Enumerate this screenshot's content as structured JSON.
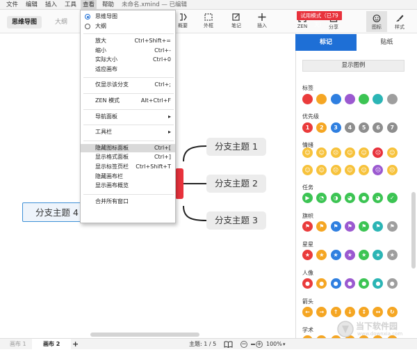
{
  "menubar": [
    "文件",
    "编辑",
    "插入",
    "工具",
    "查看",
    "帮助"
  ],
  "window_title": "未命名.xmind — 已编辑",
  "toolbar": {
    "view_tabs": [
      "思维导图",
      "大纲"
    ],
    "buttons": [
      {
        "label": "概要",
        "icon": "summary-icon"
      },
      {
        "label": "外框",
        "icon": "boundary-icon"
      },
      {
        "label": "笔记",
        "icon": "note-icon"
      },
      {
        "label": "插入",
        "icon": "plus-icon"
      },
      {
        "label": "ZEN",
        "icon": "zen-icon"
      },
      {
        "label": "分享",
        "icon": "share-icon"
      },
      {
        "label": "图标",
        "icon": "emoji-icon"
      },
      {
        "label": "样式",
        "icon": "brush-icon"
      }
    ],
    "trial_badge": "试用模式（已79天）"
  },
  "dropdown": {
    "view_modes": [
      {
        "label": "思维导图",
        "selected": true
      },
      {
        "label": "大纲",
        "selected": false
      }
    ],
    "groups": [
      [
        {
          "label": "放大",
          "shortcut": "Ctrl+Shift+="
        },
        {
          "label": "缩小",
          "shortcut": "Ctrl+-"
        },
        {
          "label": "实际大小",
          "shortcut": "Ctrl+0"
        },
        {
          "label": "适应画布",
          "shortcut": ""
        }
      ],
      [
        {
          "label": "仅显示该分支",
          "shortcut": "Ctrl+;"
        }
      ],
      [
        {
          "label": "ZEN 模式",
          "shortcut": "Alt+Ctrl+F"
        }
      ],
      [
        {
          "label": "导航面板",
          "shortcut": "▸"
        }
      ],
      [
        {
          "label": "工具栏",
          "shortcut": "▸"
        }
      ],
      [
        {
          "label": "隐藏图标面板",
          "shortcut": "Ctrl+[",
          "highlight": true
        },
        {
          "label": "显示格式面板",
          "shortcut": "Ctrl+]"
        },
        {
          "label": "显示标签页栏",
          "shortcut": "Ctrl+Shift+T"
        },
        {
          "label": "隐藏画布栏",
          "shortcut": ""
        },
        {
          "label": "显示画布概览",
          "shortcut": ""
        }
      ],
      [
        {
          "label": "合并所有窗口",
          "shortcut": ""
        }
      ]
    ]
  },
  "canvas": {
    "topics": [
      "分支主题 1",
      "分支主题 2",
      "分支主题 3",
      "分支主题 4"
    ]
  },
  "panel": {
    "tabs": [
      "标记",
      "贴纸"
    ],
    "show_legend": "显示图例",
    "categories": [
      {
        "name": "标签",
        "icons": [
          {
            "c": "#ea3b3b",
            "t": ""
          },
          {
            "c": "#f5a623",
            "t": ""
          },
          {
            "c": "#2f7fe0",
            "t": ""
          },
          {
            "c": "#9b59d0",
            "t": ""
          },
          {
            "c": "#3cc453",
            "t": ""
          },
          {
            "c": "#2bb5b5",
            "t": ""
          },
          {
            "c": "#9e9e9e",
            "t": ""
          }
        ]
      },
      {
        "name": "优先级",
        "icons": [
          {
            "c": "#ea3b3b",
            "t": "1"
          },
          {
            "c": "#f5a623",
            "t": "2"
          },
          {
            "c": "#2f7fe0",
            "t": "3"
          },
          {
            "c": "#8e8e8e",
            "t": "4"
          },
          {
            "c": "#8e8e8e",
            "t": "5"
          },
          {
            "c": "#8e8e8e",
            "t": "6"
          },
          {
            "c": "#8e8e8e",
            "t": "7"
          }
        ]
      },
      {
        "name": "情绪",
        "icons": [
          {
            "c": "#f7c23b",
            "t": "☺"
          },
          {
            "c": "#f7c23b",
            "t": "☺"
          },
          {
            "c": "#f7c23b",
            "t": "☹"
          },
          {
            "c": "#f7c23b",
            "t": "☺"
          },
          {
            "c": "#f7c23b",
            "t": "☺"
          },
          {
            "c": "#e8323c",
            "t": "☹"
          },
          {
            "c": "#f7c23b",
            "t": "☺"
          }
        ]
      },
      {
        "name": "",
        "icons": [
          {
            "c": "#f7c23b",
            "t": "☺"
          },
          {
            "c": "#f7c23b",
            "t": "☺"
          },
          {
            "c": "#f7c23b",
            "t": "☹"
          },
          {
            "c": "#f7c23b",
            "t": "☺"
          },
          {
            "c": "#f7c23b",
            "t": "☺"
          },
          {
            "c": "#9b59d0",
            "t": "☹"
          },
          {
            "c": "#f7c23b",
            "t": "☹"
          }
        ]
      },
      {
        "name": "任务",
        "icons": [
          {
            "c": "#3cc453",
            "t": "▶"
          },
          {
            "c": "#3cc453",
            "t": "◔"
          },
          {
            "c": "#3cc453",
            "t": "◑"
          },
          {
            "c": "#3cc453",
            "t": "◕"
          },
          {
            "c": "#3cc453",
            "t": "●"
          },
          {
            "c": "#3cc453",
            "t": "◕"
          },
          {
            "c": "#3cc453",
            "t": "✓"
          }
        ]
      },
      {
        "name": "旗帜",
        "icons": [
          {
            "c": "#ea3b3b",
            "t": "⚑"
          },
          {
            "c": "#f5a623",
            "t": "⚑"
          },
          {
            "c": "#2f7fe0",
            "t": "⚑"
          },
          {
            "c": "#9b59d0",
            "t": "⚑"
          },
          {
            "c": "#3cc453",
            "t": "⚑"
          },
          {
            "c": "#2bb5b5",
            "t": "⚑"
          },
          {
            "c": "#9e9e9e",
            "t": "⚑"
          }
        ]
      },
      {
        "name": "星星",
        "icons": [
          {
            "c": "#ea3b3b",
            "t": "★"
          },
          {
            "c": "#f5a623",
            "t": "★"
          },
          {
            "c": "#2f7fe0",
            "t": "★"
          },
          {
            "c": "#9b59d0",
            "t": "★"
          },
          {
            "c": "#3cc453",
            "t": "★"
          },
          {
            "c": "#2bb5b5",
            "t": "★"
          },
          {
            "c": "#9e9e9e",
            "t": "★"
          }
        ]
      },
      {
        "name": "人像",
        "icons": [
          {
            "c": "#ea3b3b",
            "t": "●"
          },
          {
            "c": "#f5a623",
            "t": "●"
          },
          {
            "c": "#2f7fe0",
            "t": "●"
          },
          {
            "c": "#9b59d0",
            "t": "●"
          },
          {
            "c": "#3cc453",
            "t": "●"
          },
          {
            "c": "#2bb5b5",
            "t": "●"
          },
          {
            "c": "#9e9e9e",
            "t": "●"
          }
        ]
      },
      {
        "name": "箭头",
        "icons": [
          {
            "c": "#f5a623",
            "t": "←"
          },
          {
            "c": "#f5a623",
            "t": "→"
          },
          {
            "c": "#f5a623",
            "t": "↑"
          },
          {
            "c": "#f5a623",
            "t": "↓"
          },
          {
            "c": "#f5a623",
            "t": "↕"
          },
          {
            "c": "#f5a623",
            "t": "↔"
          },
          {
            "c": "#f5a623",
            "t": "↻"
          }
        ]
      },
      {
        "name": "学术",
        "icons": [
          {
            "c": "#f5a623",
            "t": "❝"
          },
          {
            "c": "#f5a623",
            "t": "⋯"
          },
          {
            "c": "#f5a623",
            "t": "?"
          },
          {
            "c": "#f5a623",
            "t": "!"
          },
          {
            "c": "#f5a623",
            "t": "❚❚"
          },
          {
            "c": "#f5a623",
            "t": "■"
          },
          {
            "c": "#f5a623",
            "t": "≈"
          }
        ]
      }
    ]
  },
  "status": {
    "sheets": [
      "画布 1",
      "画布 2"
    ],
    "add": "+",
    "topic_count": "主题: 1 / 5",
    "zoom_minus": "−",
    "zoom_plus": "+",
    "zoom": "100%"
  },
  "watermark": {
    "name": "当下软件园",
    "url": "www.downxia.com"
  }
}
